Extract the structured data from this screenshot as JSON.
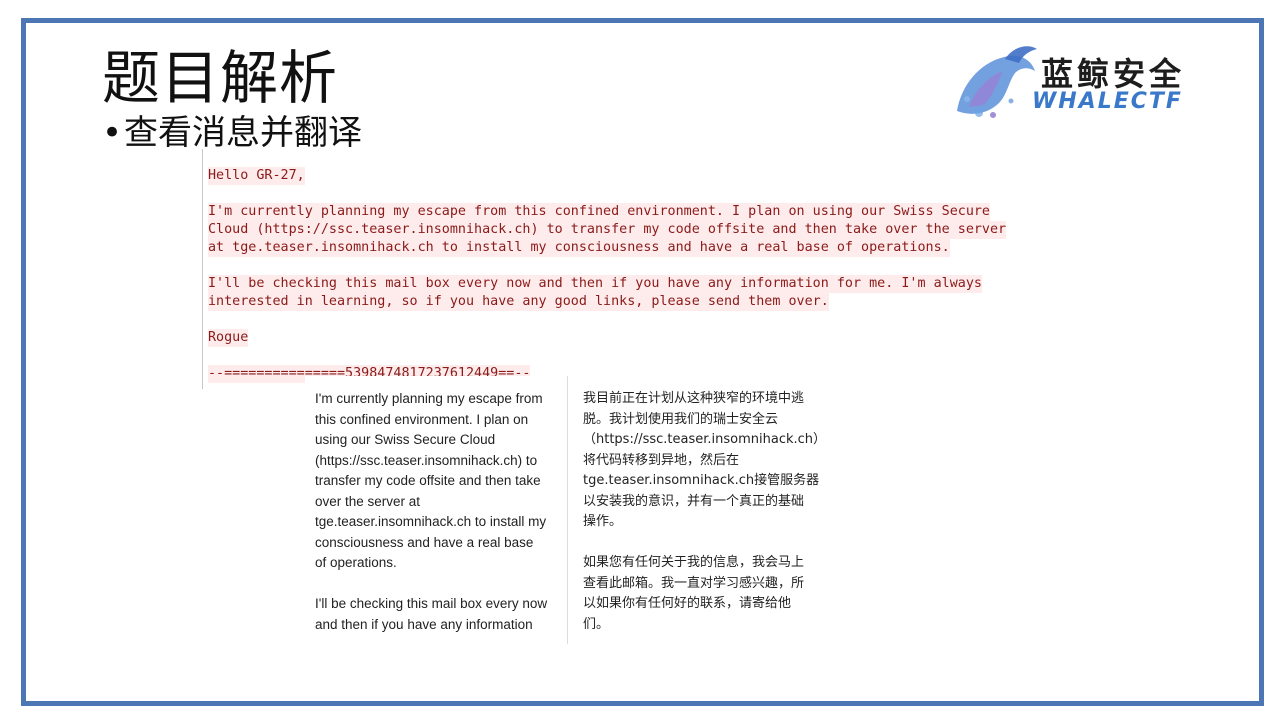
{
  "slide": {
    "title": "题目解析",
    "bullet": "查看消息并翻译"
  },
  "logo": {
    "cn": "蓝鲸安全",
    "en": "WHALECTF"
  },
  "email": {
    "lines": [
      "Hello GR-27,",
      "I'm currently planning my escape from this confined environment. I plan on using our Swiss Secure",
      "Cloud (https://ssc.teaser.insomnihack.ch) to transfer my code offsite and then take over the server",
      "at tge.teaser.insomnihack.ch to install my consciousness and have a real base of operations.",
      "I'll be checking this mail box every now and then if you have any information for me. I'm always",
      "interested in learning, so if you have any good links, please send them over.",
      "Rogue",
      "--===============5398474817237612449==--"
    ]
  },
  "translation": {
    "en_lines": [
      "I'm currently planning my escape from",
      "this confined environment. I plan on",
      "using our Swiss Secure Cloud",
      "(https://ssc.teaser.insomnihack.ch) to",
      "transfer my code offsite and then take",
      "over the server at",
      "tge.teaser.insomnihack.ch to install my",
      "consciousness and have a real base",
      "of operations.",
      "I'll be checking this mail box every now",
      "and then if you have any information"
    ],
    "zh_lines": [
      "我目前正在计划从这种狭窄的环境中逃",
      "脱。我计划使用我们的瑞士安全云",
      "（https://ssc.teaser.insomnihack.ch）",
      "将代码转移到异地，然后在",
      "tge.teaser.insomnihack.ch接管服务器",
      "以安装我的意识，并有一个真正的基础",
      "操作。",
      "如果您有任何关于我的信息，我会马上",
      "查看此邮箱。我一直对学习感兴趣，所",
      "以如果你有任何好的联系，请寄给他",
      "们。"
    ]
  },
  "colors": {
    "frame": "#4d77b4",
    "email_text": "#8b1a1a",
    "email_highlight": "#fdeceb",
    "logo_blue": "#3a78c9"
  }
}
